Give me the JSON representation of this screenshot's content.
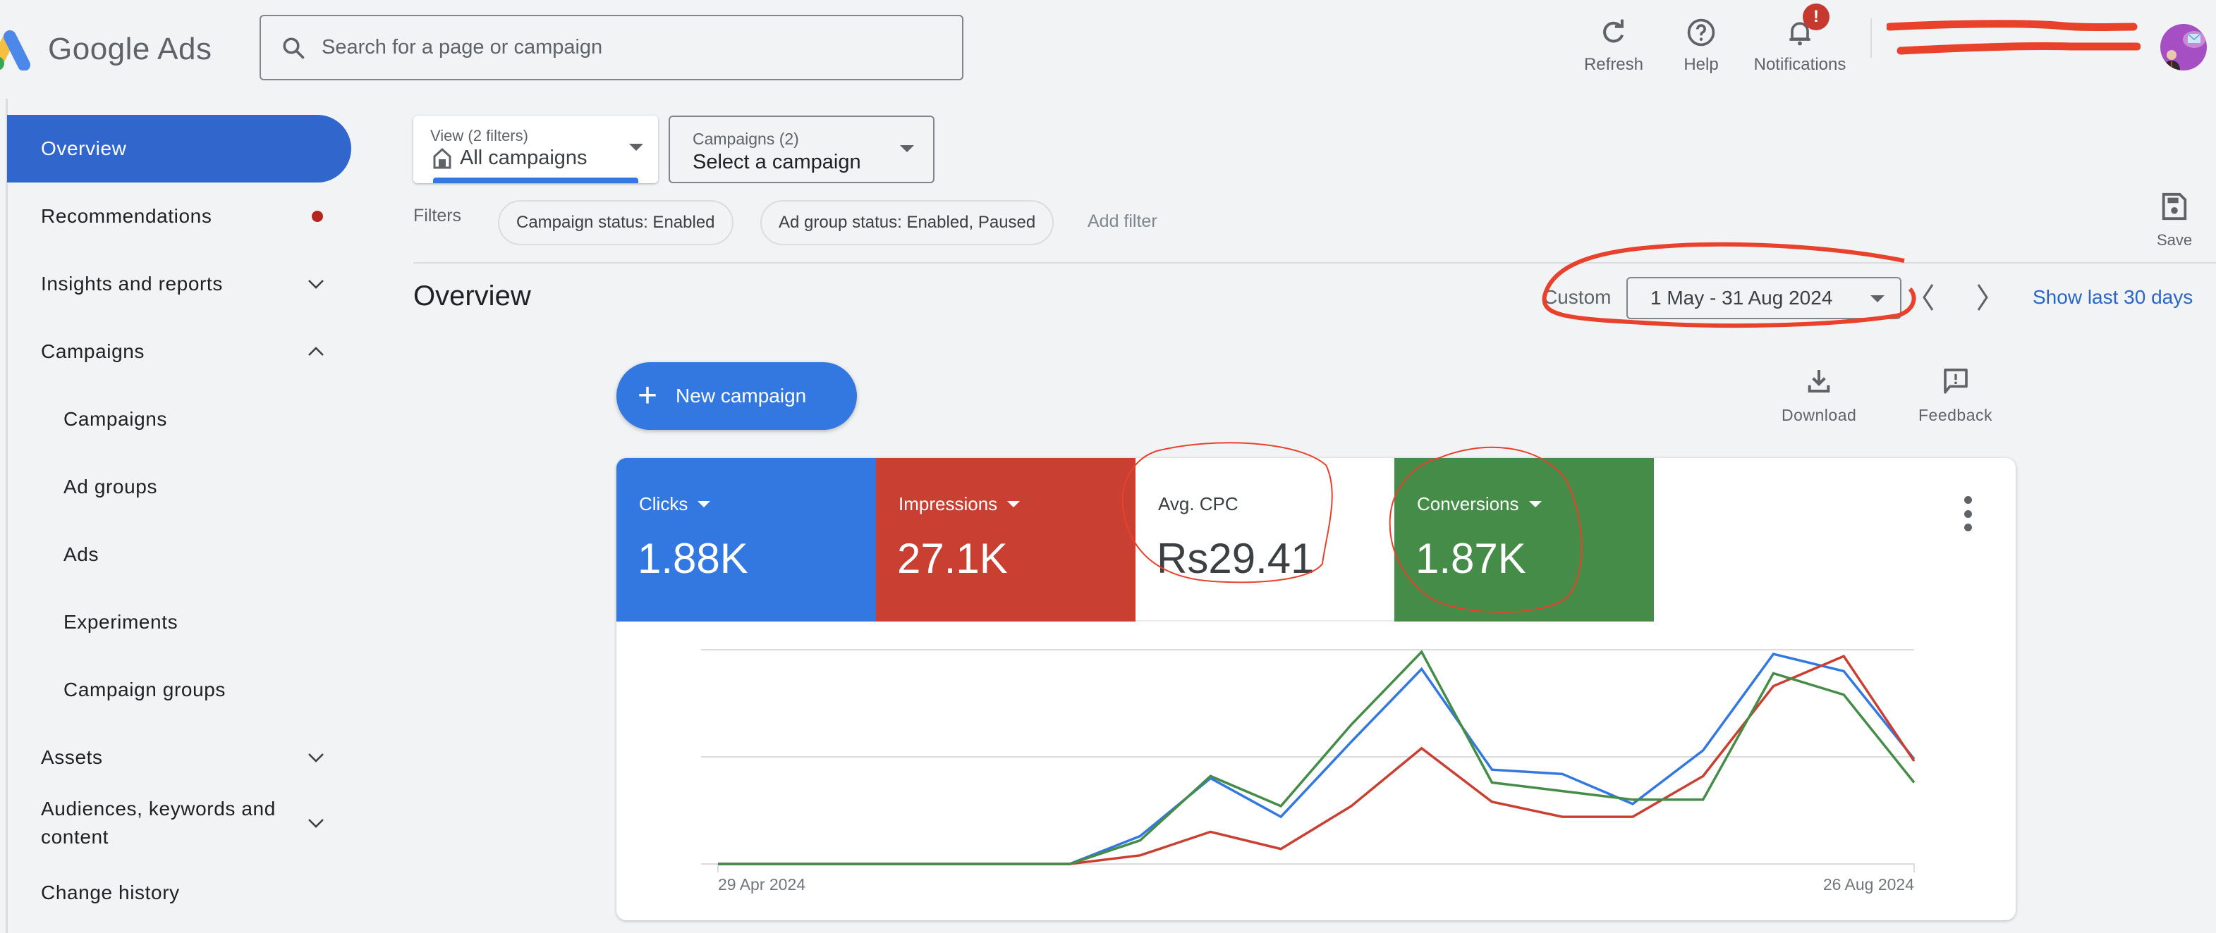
{
  "header": {
    "app_name": "Google Ads",
    "search_placeholder": "Search for a page or campaign",
    "actions": [
      {
        "label": "Refresh",
        "icon": "refresh-icon"
      },
      {
        "label": "Help",
        "icon": "help-icon"
      },
      {
        "label": "Notifications",
        "icon": "bell-icon",
        "badge": "!"
      }
    ],
    "account": {
      "redacted": true
    }
  },
  "sidebar": {
    "items": [
      {
        "label": "Overview",
        "active": true
      },
      {
        "label": "Recommendations",
        "indicator": "dot"
      },
      {
        "label": "Insights and reports",
        "expand": "chevron-down"
      },
      {
        "label": "Campaigns",
        "expand": "chevron-up"
      },
      {
        "label": "Campaigns",
        "sub": true
      },
      {
        "label": "Ad groups",
        "sub": true
      },
      {
        "label": "Ads",
        "sub": true
      },
      {
        "label": "Experiments",
        "sub": true
      },
      {
        "label": "Campaign groups",
        "sub": true
      },
      {
        "label": "Assets",
        "expand": "chevron-down"
      },
      {
        "label": "Audiences, keywords and content",
        "expand": "chevron-down"
      },
      {
        "label": "Change history"
      }
    ]
  },
  "toolbar": {
    "view": {
      "caption": "View (2 filters)",
      "value": "All campaigns"
    },
    "campaign_select": {
      "caption": "Campaigns (2)",
      "value": "Select a campaign"
    },
    "filters_label": "Filters",
    "chips": [
      "Campaign status: Enabled",
      "Ad group status: Enabled, Paused"
    ],
    "add_filter": "Add filter",
    "save_label": "Save"
  },
  "overview": {
    "title": "Overview",
    "range_type": "Custom",
    "date_range": "1 May - 31 Aug 2024",
    "show_last": "Show last 30 days",
    "new_campaign": "New campaign",
    "download": "Download",
    "feedback": "Feedback"
  },
  "metrics": [
    {
      "label": "Clicks",
      "value": "1.88K",
      "selected": true,
      "color": "#3378e0",
      "dropdown": true
    },
    {
      "label": "Impressions",
      "value": "27.1K",
      "selected": true,
      "color": "#c94032",
      "dropdown": true
    },
    {
      "label": "Avg. CPC",
      "value": "Rs29.41",
      "selected": false,
      "color": "#ffffff",
      "dropdown": false
    },
    {
      "label": "Conversions",
      "value": "1.87K",
      "selected": true,
      "color": "#458c48",
      "dropdown": true
    }
  ],
  "chart_data": {
    "type": "line",
    "title": "",
    "xlabel": "",
    "ylabel": "",
    "x_tick_labels": [
      "29 Apr 2024",
      "26 Aug 2024"
    ],
    "x": [
      "29 Apr",
      "6 May",
      "13 May",
      "20 May",
      "27 May",
      "3 Jun",
      "10 Jun",
      "17 Jun",
      "24 Jun",
      "1 Jul",
      "8 Jul",
      "15 Jul",
      "22 Jul",
      "29 Jul",
      "5 Aug",
      "12 Aug",
      "19 Aug",
      "26 Aug"
    ],
    "y_scale": "normalized per series (0 = baseline, 1 = top gridline)",
    "ylim": [
      0,
      1
    ],
    "grid": true,
    "series": [
      {
        "name": "Clicks",
        "color": "#3378e0",
        "values": [
          0,
          0,
          0,
          0,
          0,
          0,
          0.13,
          0.4,
          0.22,
          0.57,
          0.91,
          0.44,
          0.42,
          0.28,
          0.53,
          0.98,
          0.9,
          0.49
        ]
      },
      {
        "name": "Impressions",
        "color": "#c94032",
        "values": [
          0,
          0,
          0,
          0,
          0,
          0,
          0.04,
          0.15,
          0.07,
          0.27,
          0.54,
          0.29,
          0.22,
          0.22,
          0.41,
          0.83,
          0.97,
          0.48
        ]
      },
      {
        "name": "Conversions",
        "color": "#458c48",
        "values": [
          0,
          0,
          0,
          0,
          0,
          0,
          0.11,
          0.41,
          0.27,
          0.65,
          0.99,
          0.38,
          0.34,
          0.3,
          0.3,
          0.89,
          0.79,
          0.38
        ]
      }
    ]
  }
}
